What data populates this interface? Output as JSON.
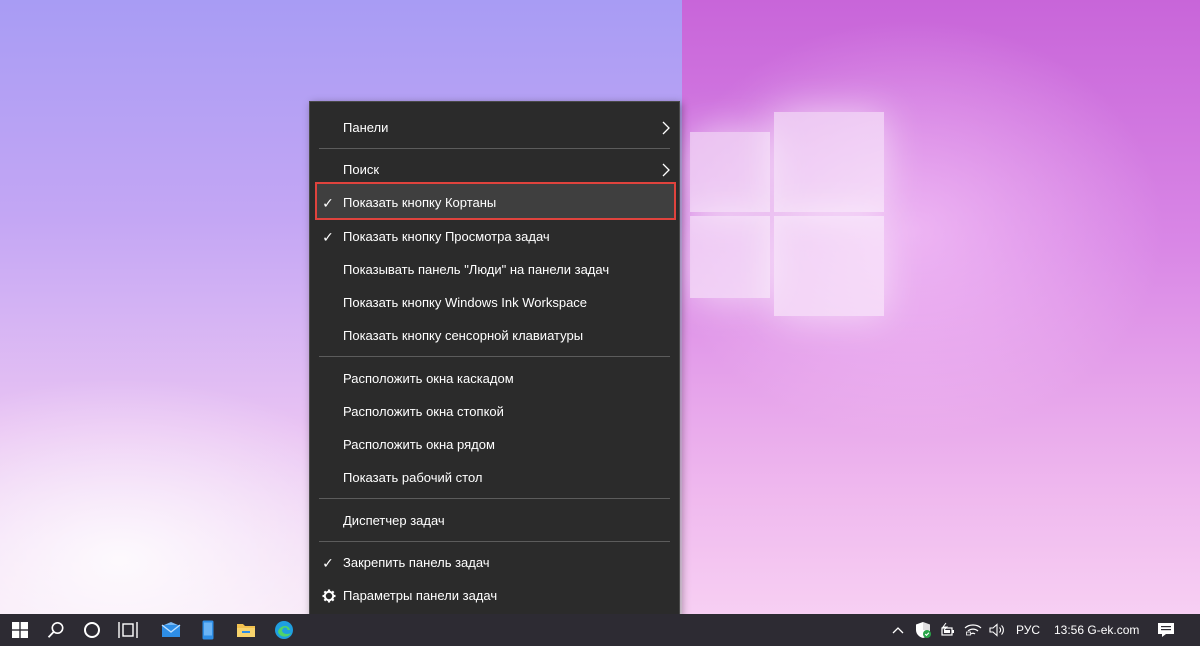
{
  "desktop": {
    "wallpaper_colors": {
      "left": "#b9a3f4",
      "right": "#d57de3"
    }
  },
  "context_menu": {
    "items": [
      {
        "label": "Панели",
        "checked": false,
        "submenu": true
      },
      {
        "label": "Поиск",
        "checked": false,
        "submenu": true
      },
      {
        "label": "Показать кнопку Кортаны",
        "checked": true,
        "highlighted": true
      },
      {
        "label": "Показать кнопку Просмотра задач",
        "checked": true
      },
      {
        "label": "Показывать панель \"Люди\" на панели задач",
        "checked": false
      },
      {
        "label": "Показать кнопку Windows Ink Workspace",
        "checked": false
      },
      {
        "label": "Показать кнопку сенсорной клавиатуры",
        "checked": false
      },
      {
        "label": "Расположить окна каскадом",
        "checked": false
      },
      {
        "label": "Расположить окна стопкой",
        "checked": false
      },
      {
        "label": "Расположить окна рядом",
        "checked": false
      },
      {
        "label": "Показать рабочий стол",
        "checked": false
      },
      {
        "label": "Диспетчер задач",
        "checked": false
      },
      {
        "label": "Закрепить панель задач",
        "checked": true
      },
      {
        "label": "Параметры панели задач",
        "checked": false,
        "icon": "gear-icon"
      }
    ],
    "check_glyph": "✓",
    "arrow_glyph": "›",
    "highlight_color": "#e0433d"
  },
  "taskbar": {
    "icons": [
      "windows-start-icon",
      "search-icon",
      "cortana-icon",
      "task-view-icon",
      "mail-icon",
      "phone-icon",
      "file-explorer-icon",
      "edge-icon"
    ],
    "tray": {
      "language": "РУС",
      "clock": "13:56 G-ek.com"
    },
    "colors": {
      "background": "#2d2b33",
      "accent_blue": "#2e8ee6"
    }
  }
}
